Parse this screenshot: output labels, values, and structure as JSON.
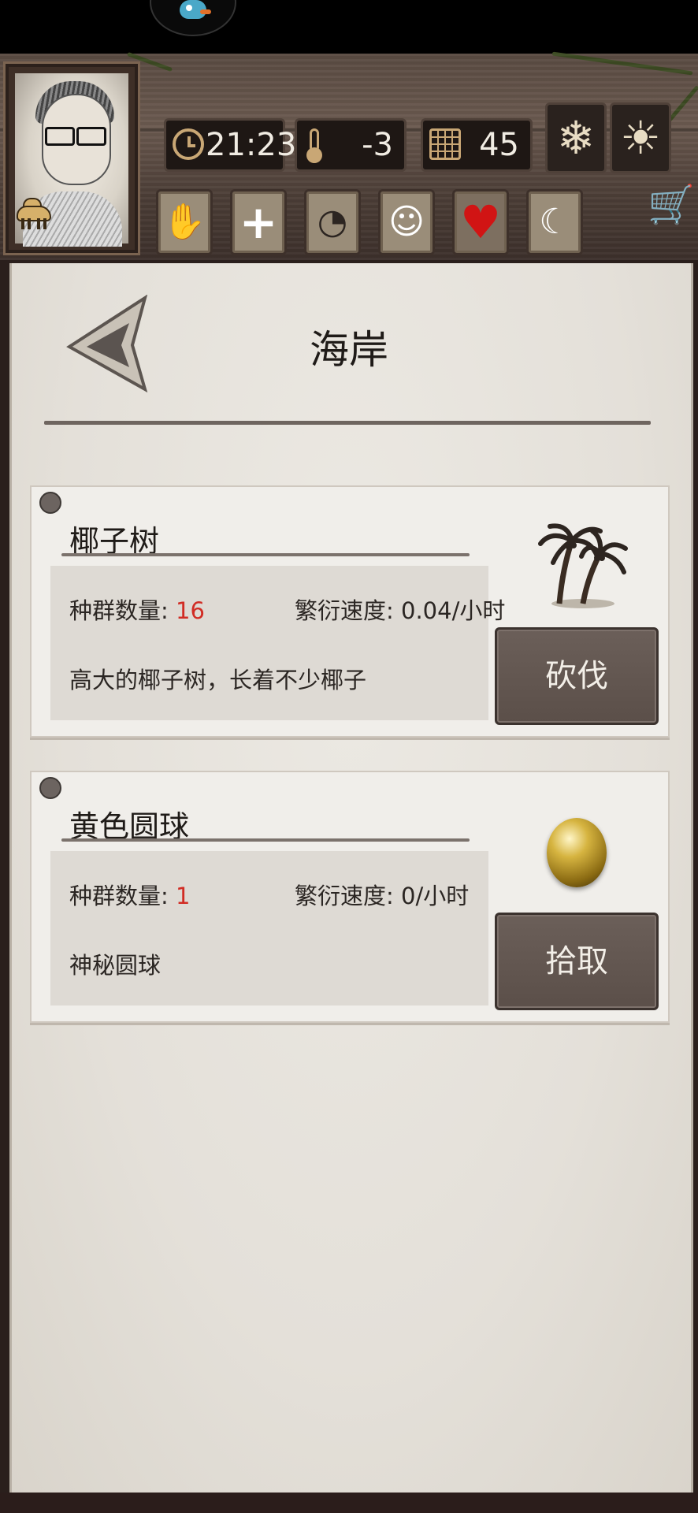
{
  "hud": {
    "time": "21:23",
    "temperature": "-3",
    "day": "45"
  },
  "location": {
    "title": "海岸"
  },
  "resources": [
    {
      "name": "椰子树",
      "population_label": "种群数量:",
      "population_value": "16",
      "rate_label": "繁衍速度:",
      "rate_value": "0.04/小时",
      "description": "高大的椰子树，长着不少椰子",
      "action": "砍伐",
      "icon": "palm-tree-icon"
    },
    {
      "name": "黄色圆球",
      "population_label": "种群数量:",
      "population_value": "1",
      "rate_label": "繁衍速度:",
      "rate_value": "0/小时",
      "description": "神秘圆球",
      "action": "拾取",
      "icon": "yellow-orb-icon"
    }
  ],
  "colors": {
    "accent_number": "#d12c24",
    "button_bg": "#5b4f49",
    "paper": "#e6e2dc"
  }
}
